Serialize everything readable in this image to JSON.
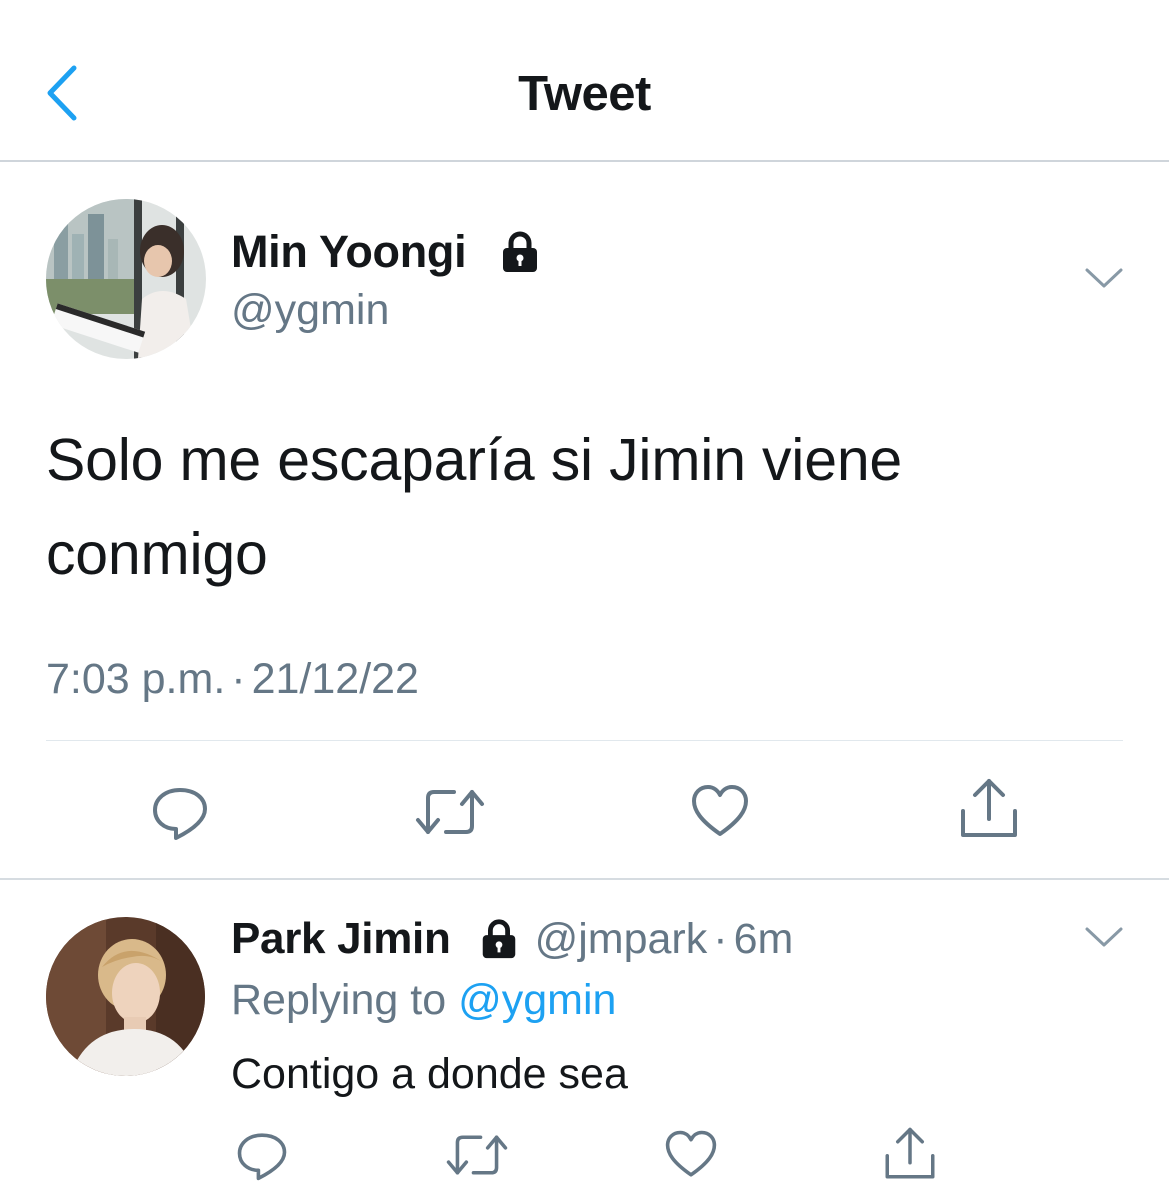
{
  "header": {
    "title": "Tweet",
    "back_icon": "chevron-left-icon",
    "accent_color": "#1da1f2"
  },
  "main_tweet": {
    "author_name": "Min Yoongi",
    "handle": "@ygmin",
    "protected": true,
    "text": "Solo me escaparía si Jimin viene conmigo",
    "time": "7:03 p.m.",
    "separator": "·",
    "date": "21/12/22",
    "actions": [
      "reply-icon",
      "retweet-icon",
      "like-icon",
      "share-icon"
    ]
  },
  "reply": {
    "author_name": "Park Jimin",
    "handle": "@jmpark",
    "separator": "·",
    "time": "6m",
    "protected": true,
    "replying_label": "Replying to",
    "replying_to": "@ygmin",
    "text": "Contigo a donde sea",
    "actions": [
      "reply-icon",
      "retweet-icon",
      "like-icon",
      "share-icon"
    ]
  },
  "colors": {
    "text_primary": "#14171a",
    "text_secondary": "#657786",
    "icon_gray": "#657786",
    "divider": "#e1e8ed"
  }
}
